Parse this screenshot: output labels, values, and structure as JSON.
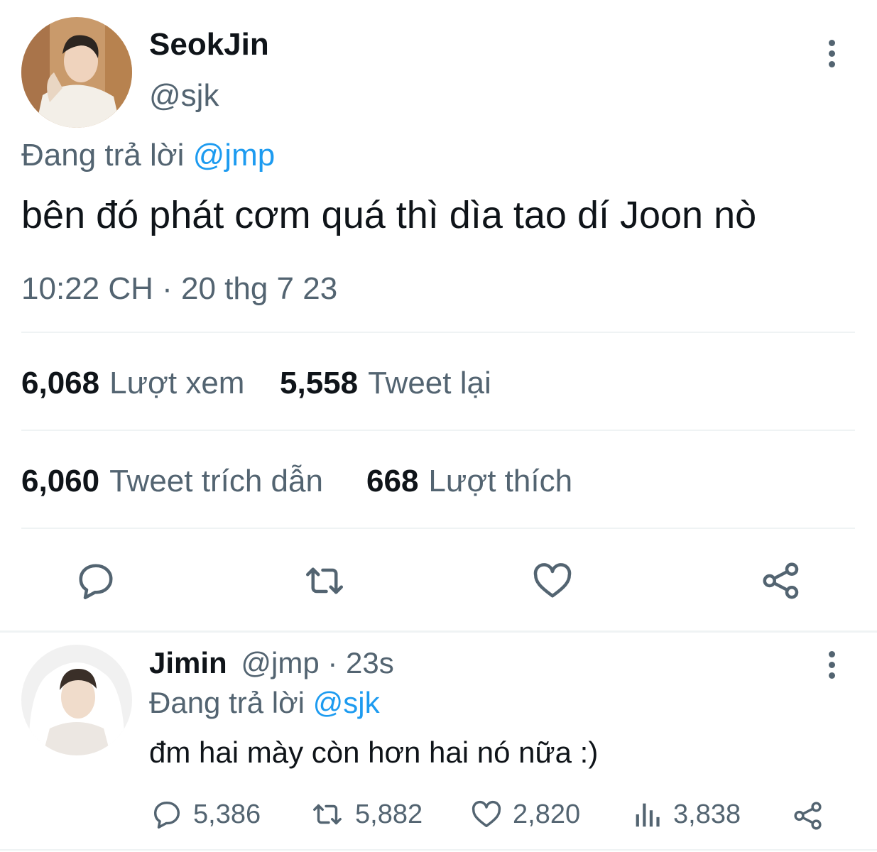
{
  "main_tweet": {
    "display_name": "SeokJin",
    "handle": "@sjk",
    "replying_label": "Đang trả lời",
    "replying_to": "@jmp",
    "text": "bên đó phát cơm quá thì dìa tao dí Joon nò",
    "timestamp": "10:22 CH · 20 thg 7 23",
    "stats": [
      {
        "value": "6,068",
        "label": "Lượt xem"
      },
      {
        "value": "5,558",
        "label": "Tweet lại"
      },
      {
        "value": "6,060",
        "label": "Tweet trích dẫn"
      },
      {
        "value": "668",
        "label": "Lượt thích"
      }
    ],
    "actions": [
      "reply-icon",
      "retweet-icon",
      "like-icon",
      "share-icon"
    ]
  },
  "reply_tweet": {
    "display_name": "Jimin",
    "handle_time": "@jmp · 23s",
    "replying_label": "Đang trả lời",
    "replying_to": "@sjk",
    "text": "đm hai mày còn hơn hai nó nữa :)",
    "metrics": {
      "replies": "5,386",
      "retweets": "5,882",
      "likes": "2,820",
      "views": "3,838"
    }
  },
  "colors": {
    "text": "#0f1419",
    "secondary": "#536471",
    "link": "#1d9bf0",
    "divider": "#eff3f4"
  }
}
